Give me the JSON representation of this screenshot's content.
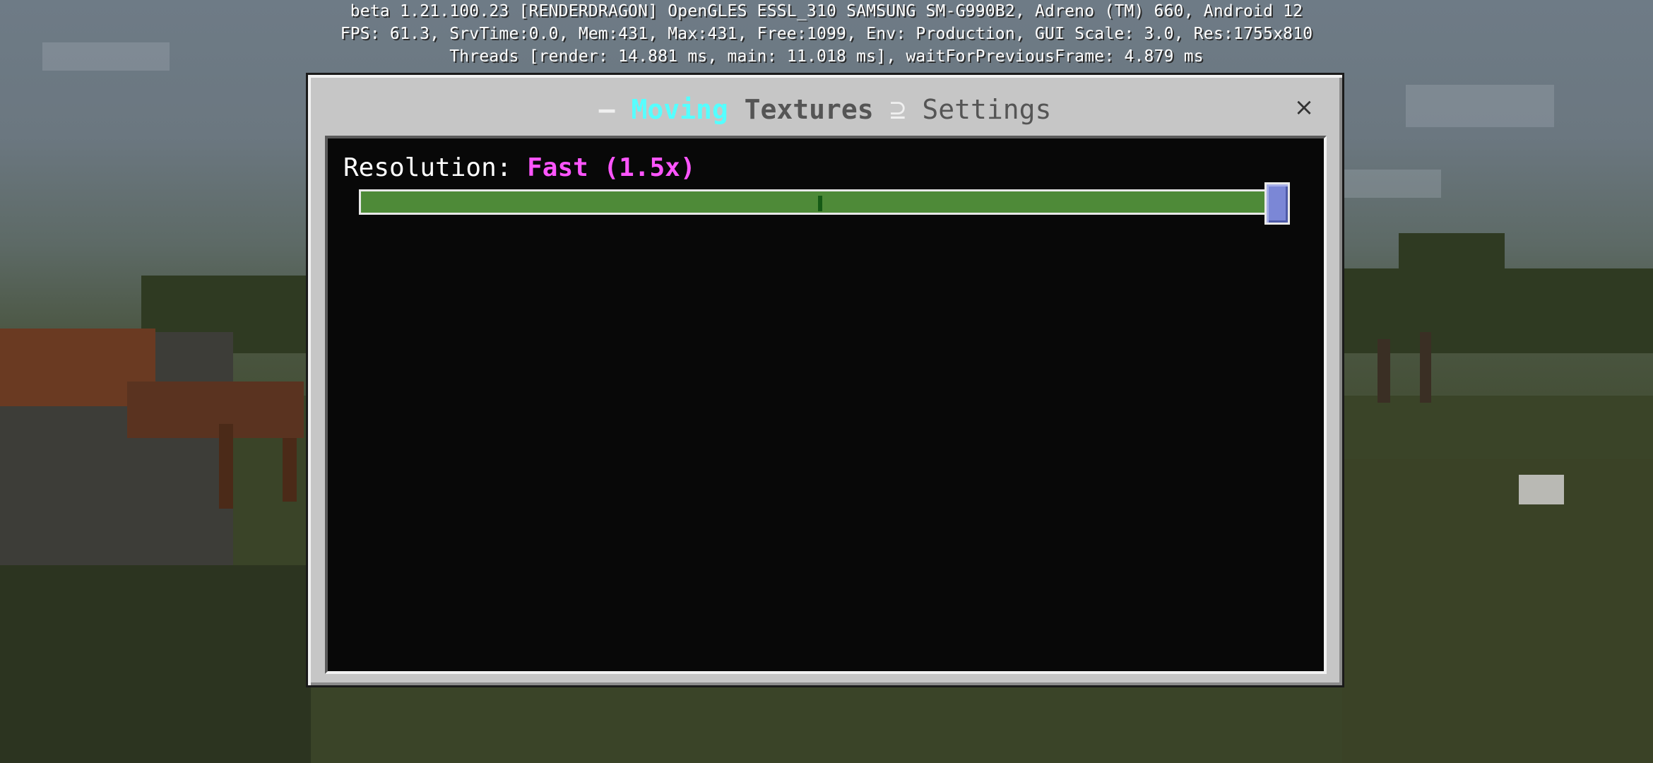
{
  "debug": {
    "line1": "beta 1.21.100.23 [RENDERDRAGON] OpenGLES ESSL_310 SAMSUNG SM-G990B2, Adreno (TM) 660, Android 12",
    "line2": "FPS: 61.3, SrvTime:0.0, Mem:431, Max:431, Free:1099, Env: Production, GUI Scale: 3.0, Res:1755x810",
    "line3": "Threads [render: 14.881 ms, main: 11.018 ms], waitForPreviousFrame: 4.879 ms"
  },
  "panel": {
    "title_dash": "–",
    "title_moving": "Moving",
    "title_textures": "Textures",
    "title_separator": "⊇",
    "title_settings": "Settings",
    "close_icon": "×"
  },
  "setting": {
    "label": "Resolution:",
    "value": "Fast (1.5x)",
    "slider": {
      "steps": 3,
      "selected_index": 2,
      "track_color": "#4e8a38",
      "step_marker_color": "#155a15",
      "thumb_color": "#7b87d6"
    }
  },
  "colors": {
    "accent_cyan": "#55ffff",
    "accent_magenta": "#ff55ff",
    "panel_gray": "#c6c6c6",
    "content_black": "#080808"
  }
}
